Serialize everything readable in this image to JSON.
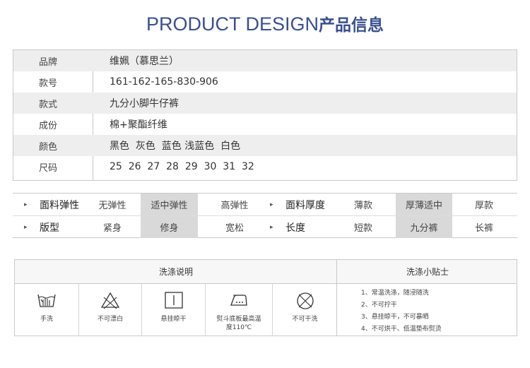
{
  "title": {
    "en": "PRODUCT DESIGN",
    "cn": "产品信息"
  },
  "specs": [
    {
      "key": "品牌",
      "value": "维姵（慕思兰）"
    },
    {
      "key": "款号",
      "value": "161-162-165-830-906"
    },
    {
      "key": "款式",
      "value": "九分小脚牛仔裤"
    },
    {
      "key": "成份",
      "value": "棉+聚酯纤维"
    },
    {
      "key": "颜色",
      "value": "黑色  灰色  蓝色 浅蓝色  白色"
    },
    {
      "key": "尺码",
      "value": "25  26  27  28  29  30  31  32"
    }
  ],
  "attributes": {
    "row1_left": {
      "name": "面料弹性",
      "options": [
        "无弹性",
        "适中弹性",
        "高弹性"
      ],
      "selected": 1
    },
    "row1_right": {
      "name": "面料厚度",
      "options": [
        "薄款",
        "厚薄适中",
        "厚款"
      ],
      "selected": 1
    },
    "row2_left": {
      "name": "版型",
      "options": [
        "紧身",
        "修身",
        "宽松"
      ],
      "selected": 1
    },
    "row2_right": {
      "name": "长度",
      "options": [
        "短款",
        "九分裤",
        "长裤"
      ],
      "selected": 1
    },
    "arrow_glyph": "▸"
  },
  "wash": {
    "header_left": "洗涤说明",
    "header_right": "洗涤小贴士",
    "icons": [
      {
        "icon": "hand-wash-icon",
        "label": "手洗"
      },
      {
        "icon": "no-bleach-icon",
        "label": "不可漂白"
      },
      {
        "icon": "hang-dry-icon",
        "label": "悬挂晾干"
      },
      {
        "icon": "iron-icon",
        "label": "熨斗底板最高温度110℃"
      },
      {
        "icon": "no-dry-clean-icon",
        "label": "不可干洗"
      }
    ],
    "tips": [
      "1、常温洗涤，随浸随洗",
      "2、不可拧干",
      "3、悬挂晾干，不可暴晒",
      "4、不可烘干、低温垫布熨烫"
    ]
  }
}
